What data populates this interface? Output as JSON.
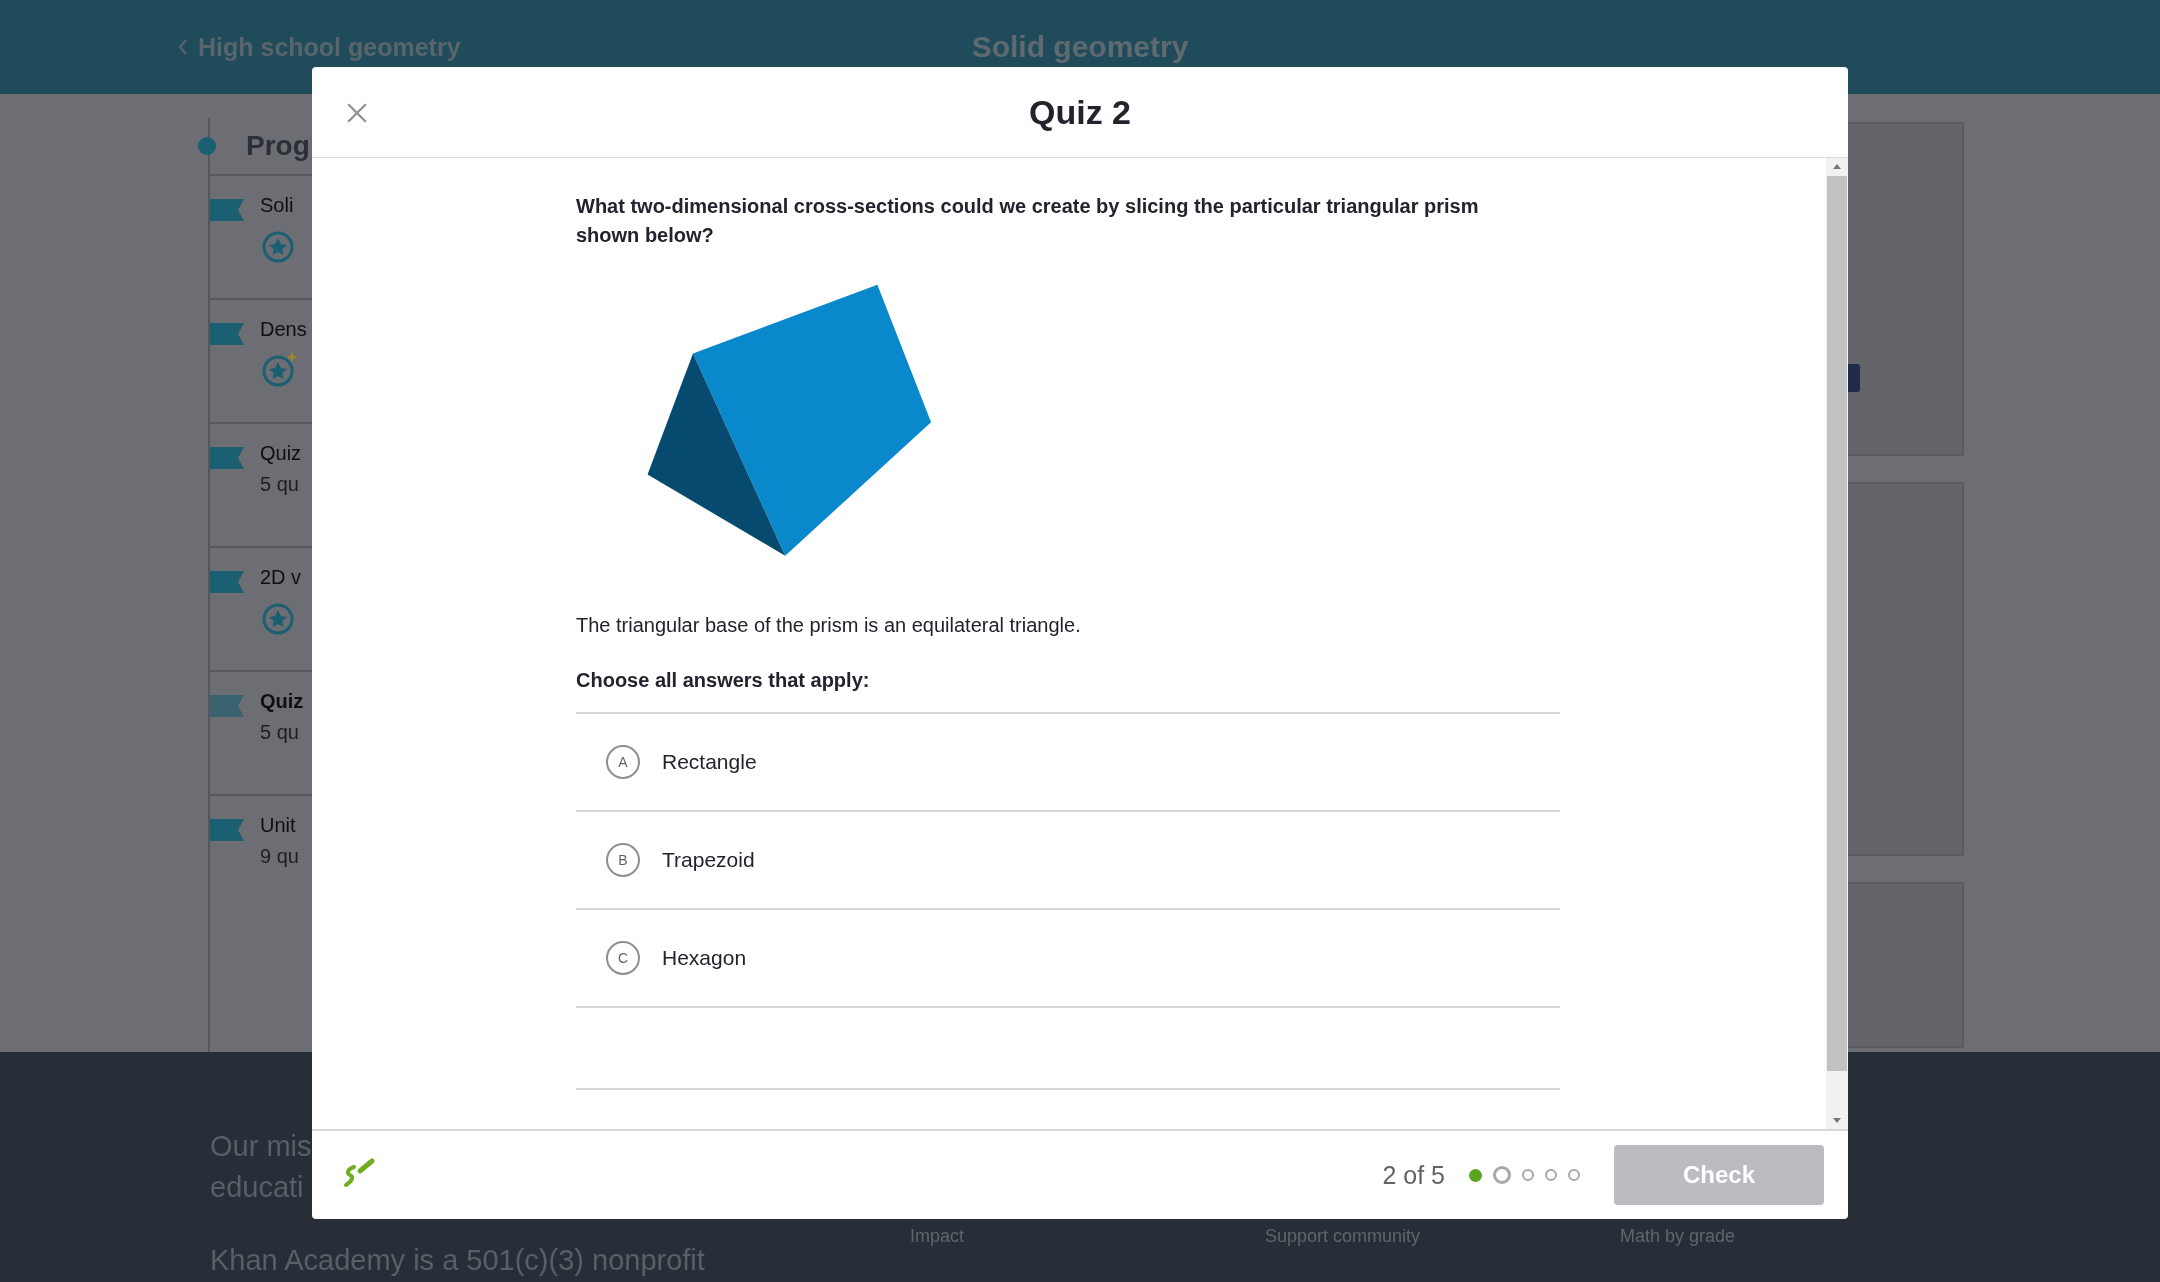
{
  "header": {
    "back_link": "High school geometry",
    "title": "Solid geometry"
  },
  "sidebar": {
    "heading": "Prog",
    "units": [
      {
        "title": "Soli",
        "kind": "star",
        "selected": false
      },
      {
        "title": "Dens",
        "kind": "star-sparkle",
        "selected": false
      },
      {
        "title": "Quiz",
        "subtitle": "5 qu",
        "selected": false
      },
      {
        "title": "2D v",
        "kind": "star",
        "selected": false
      },
      {
        "title": "Quiz",
        "subtitle": "5 qu",
        "selected": true
      },
      {
        "title": "Unit",
        "subtitle": "9 qu",
        "selected": false
      }
    ]
  },
  "footer": {
    "mission": [
      "Our mis",
      "educati"
    ],
    "nonprofit": "Khan Academy is a 501(c)(3) nonprofit",
    "links": [
      "Impact",
      "Support community",
      "Math by grade"
    ]
  },
  "modal": {
    "title": "Quiz 2",
    "question": "What two-dimensional cross-sections could we create by slicing the particular triangular prism shown below?",
    "note": "The triangular base of the prism is an equilateral triangle.",
    "prompt": "Choose all answers that apply:",
    "choices": [
      {
        "letter": "A",
        "label": "Rectangle",
        "selected": false
      },
      {
        "letter": "B",
        "label": "Trapezoid",
        "selected": false
      },
      {
        "letter": "C",
        "label": "Hexagon",
        "selected": false
      }
    ],
    "progress": "2 of 5",
    "steps": [
      {
        "kind": "done"
      },
      {
        "kind": "current"
      },
      {
        "kind": "upcoming"
      },
      {
        "kind": "upcoming"
      },
      {
        "kind": "upcoming"
      }
    ],
    "check_button": {
      "label": "Check",
      "disabled": true
    }
  }
}
